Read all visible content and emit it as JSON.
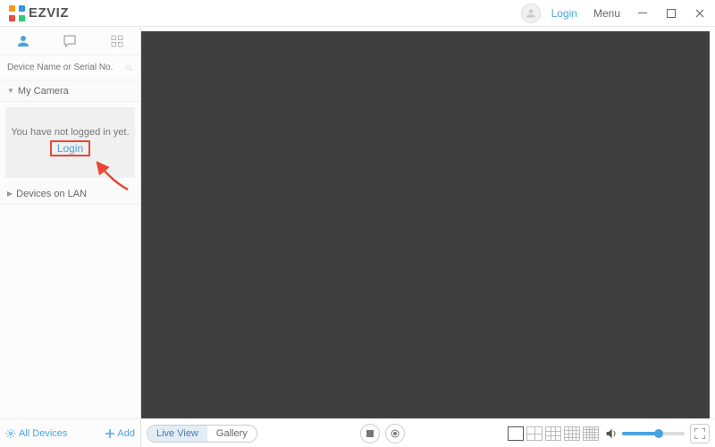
{
  "titlebar": {
    "brand": "EZVIZ",
    "login": "Login",
    "menu": "Menu"
  },
  "sidebar": {
    "search_placeholder": "Device Name or Serial No.",
    "sections": {
      "my_camera": "My Camera",
      "devices_on_lan": "Devices on LAN"
    },
    "login_panel": {
      "message": "You have not logged in yet.",
      "login": "Login"
    }
  },
  "bottom": {
    "all_devices": "All Devices",
    "add": "Add",
    "tabs": {
      "live_view": "Live View",
      "gallery": "Gallery"
    },
    "volume_percent": 55
  }
}
